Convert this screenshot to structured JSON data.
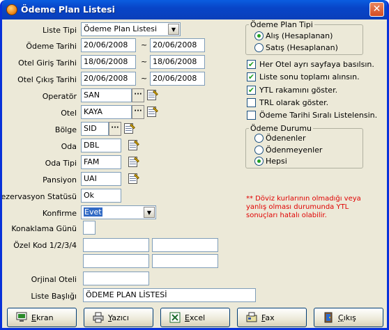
{
  "window": {
    "title": "Ödeme Plan Listesi",
    "close_label": "✕"
  },
  "form": {
    "liste_tipi": {
      "label": "Liste Tipi",
      "value": "Ödeme Plan Listesi"
    },
    "odeme_tarihi": {
      "label": "Ödeme Tarihi",
      "from": "20/06/2008",
      "sep": "~",
      "to": "20/06/2008"
    },
    "otel_giris": {
      "label": "Otel Giriş Tarihi",
      "from": "18/06/2008",
      "sep": "~",
      "to": "18/06/2008"
    },
    "otel_cikis": {
      "label": "Otel Çıkış Tarihi",
      "from": "20/06/2008",
      "sep": "~",
      "to": "20/06/2008"
    },
    "operator": {
      "label": "Operatör",
      "value": "SAN",
      "dots": "···"
    },
    "otel": {
      "label": "Otel",
      "value": "KAYA",
      "dots": "···"
    },
    "bolge": {
      "label": "Bölge",
      "value": "SID",
      "dots": "···"
    },
    "oda": {
      "label": "Oda",
      "value": "DBL"
    },
    "oda_tipi": {
      "label": "Oda Tipi",
      "value": "FAM"
    },
    "pansiyon": {
      "label": "Pansiyon",
      "value": "UAI"
    },
    "rezervasyon_statusu": {
      "label": "Rezervasyon Statüsü",
      "value": "Ok"
    },
    "konfirme": {
      "label": "Konfirme",
      "value": "Evet"
    },
    "konaklama_gunu": {
      "label": "Konaklama Günü",
      "value": ""
    },
    "ozel_kod": {
      "label": "Özel Kod 1/2/3/4",
      "k1": "",
      "k2": "",
      "k3": "",
      "k4": ""
    },
    "orijinal_oteli": {
      "label": "Orjinal Oteli",
      "value": ""
    },
    "liste_basligi": {
      "label": "Liste Başlığı",
      "value": "ÖDEME PLAN LİSTESİ"
    }
  },
  "odeme_plan_tipi": {
    "legend": "Ödeme Plan Tipi",
    "options": [
      {
        "label": "Alış (Hesaplanan)",
        "selected": true
      },
      {
        "label": "Satış (Hesaplanan)",
        "selected": false
      }
    ]
  },
  "options": [
    {
      "label": "Her Otel ayrı sayfaya basılsın.",
      "checked": true
    },
    {
      "label": "Liste sonu toplamı alınsın.",
      "checked": true
    },
    {
      "label": "YTL rakamını göster.",
      "checked": true
    },
    {
      "label": "TRL olarak göster.",
      "checked": false
    },
    {
      "label": "Ödeme Tarihi Sıralı Listelensin.",
      "checked": false
    }
  ],
  "odeme_durumu": {
    "legend": "Ödeme Durumu",
    "options": [
      {
        "label": "Ödenenler",
        "selected": false
      },
      {
        "label": "Ödenmeyenler",
        "selected": false
      },
      {
        "label": "Hepsi",
        "selected": true
      }
    ]
  },
  "note": "** Döviz kurlarının olmadığı veya yanlış olması durumunda YTL sonuçları hatalı olabilir.",
  "buttons": {
    "ekran": {
      "hot": "E",
      "rest": "kran"
    },
    "yazici": {
      "hot": "Y",
      "rest": "azıcı"
    },
    "excel": {
      "hot": "E",
      "rest": "xcel"
    },
    "fax": {
      "hot": "F",
      "rest": "ax"
    },
    "cikis": {
      "hot": "Ç",
      "rest": "ıkış"
    }
  },
  "colors": {
    "titlebar": "#0a5de0",
    "note_text": "#e00000",
    "selection": "#316ac5"
  }
}
